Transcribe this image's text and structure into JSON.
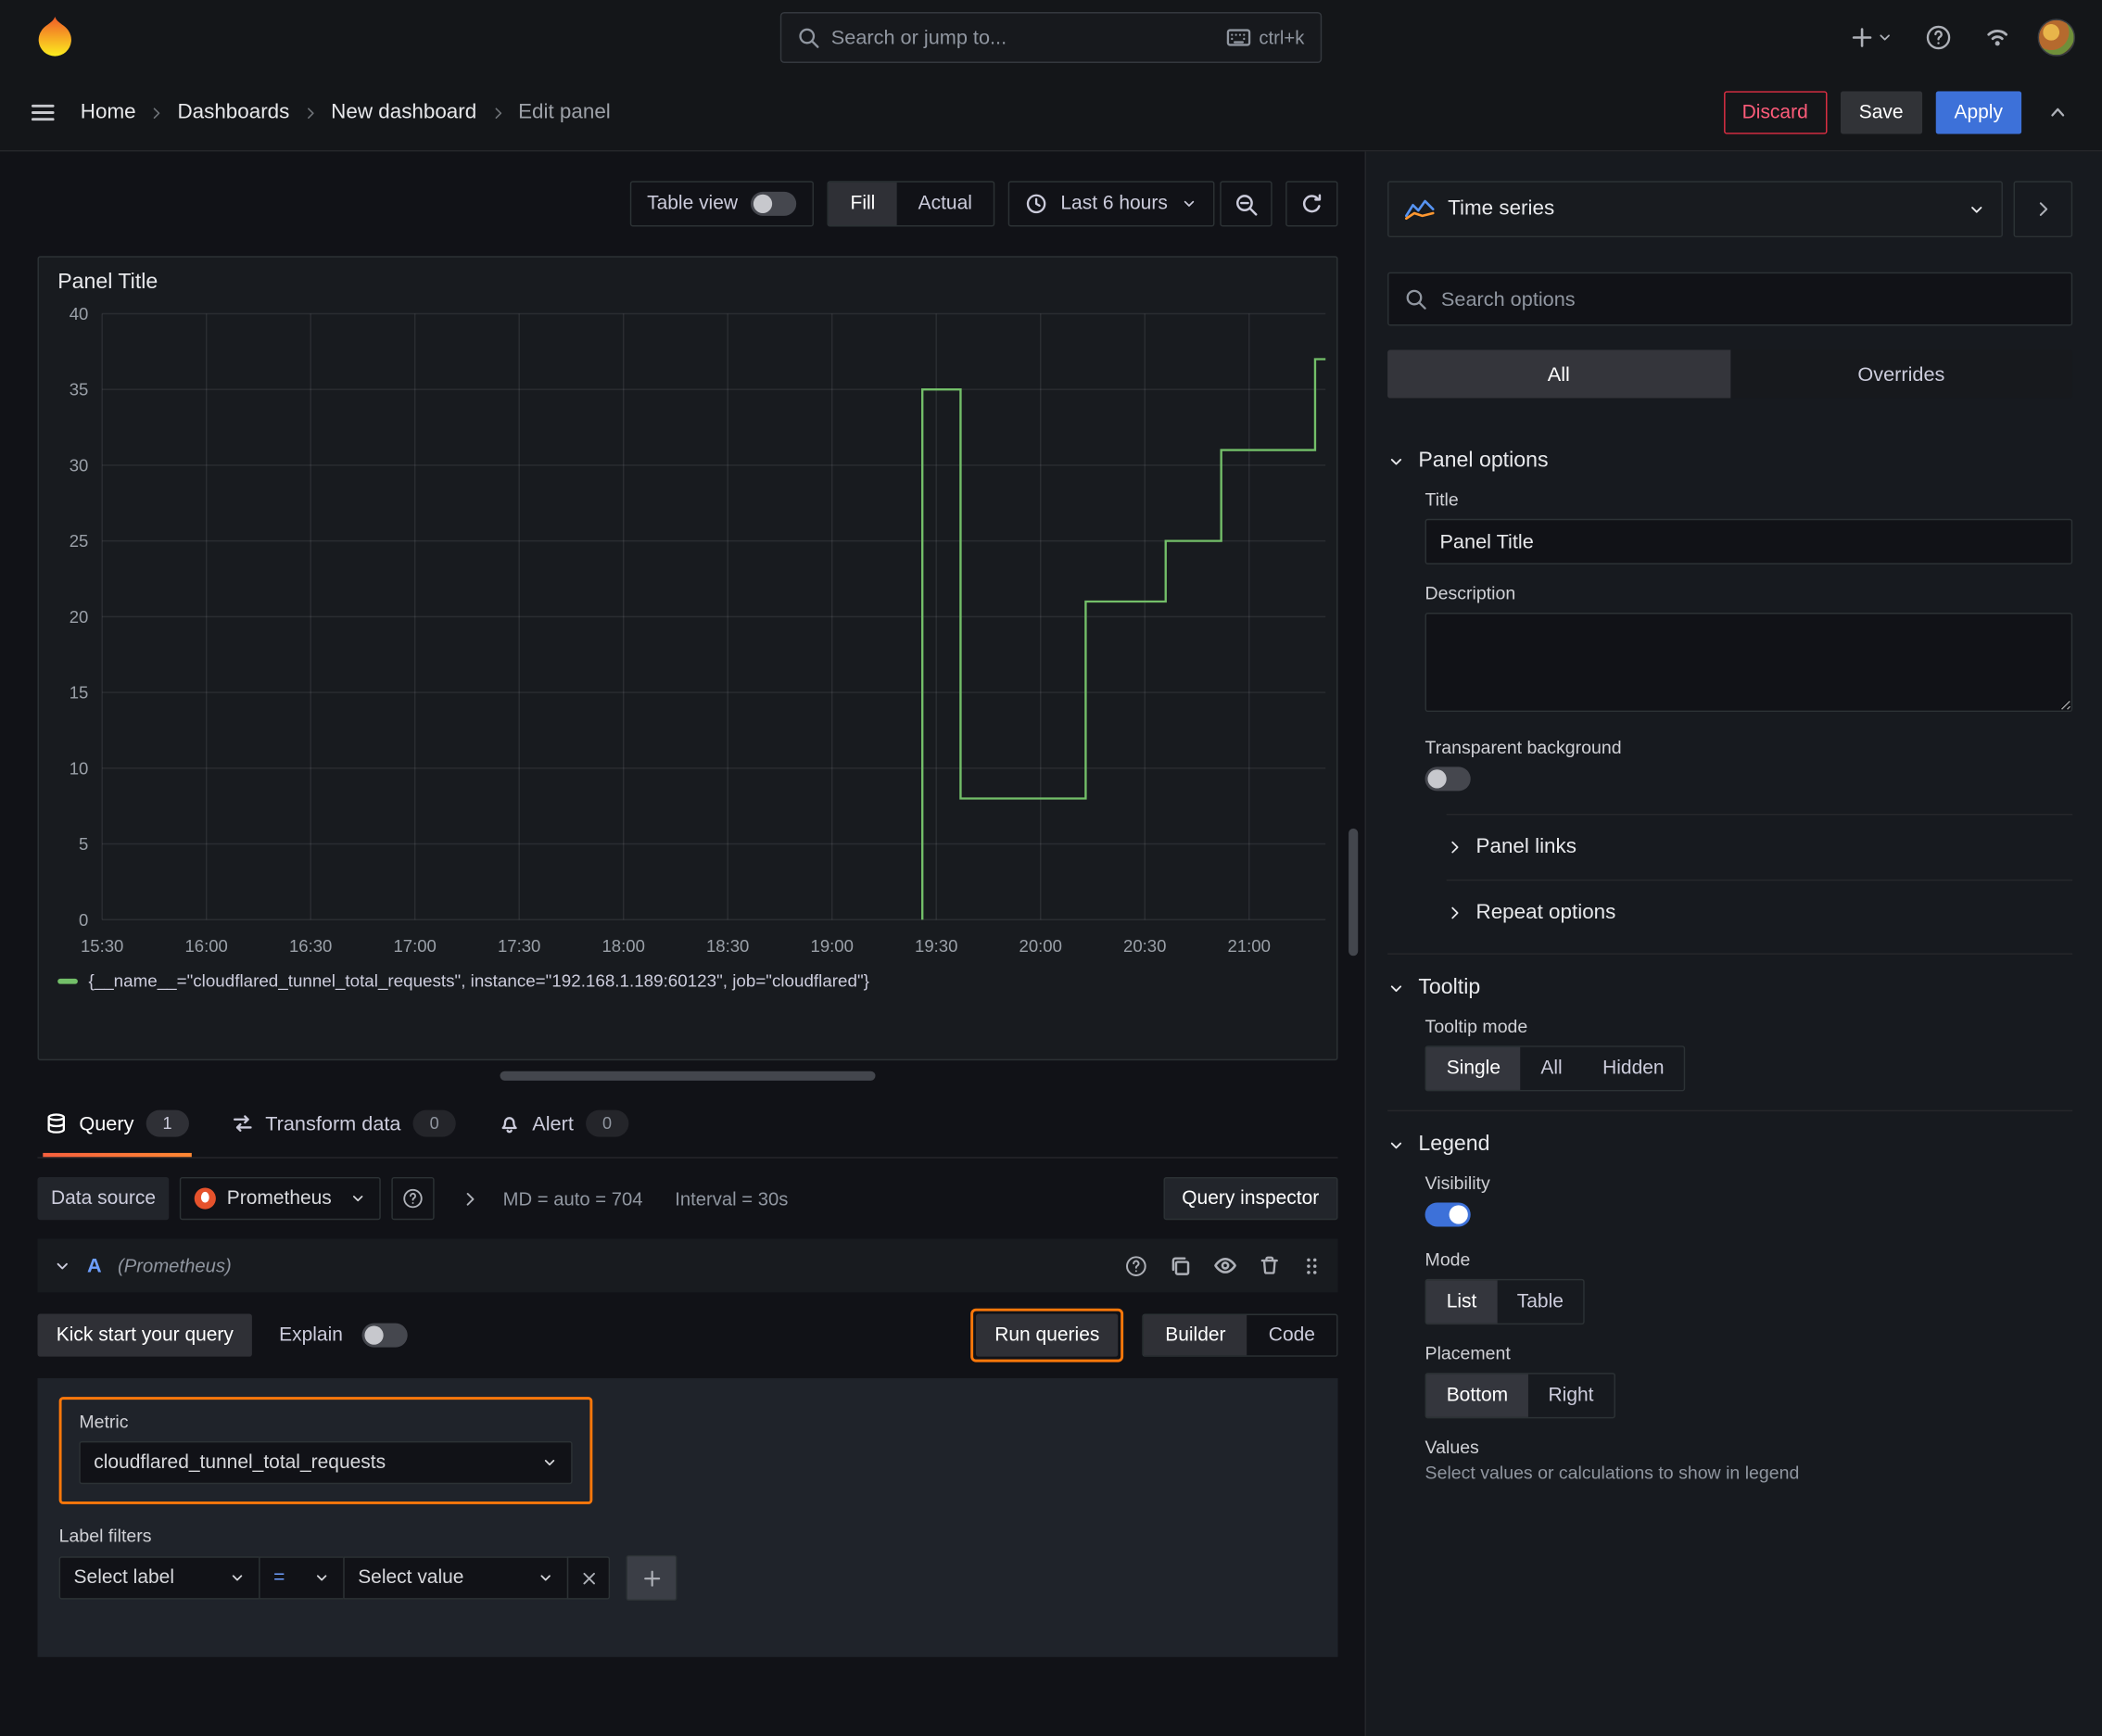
{
  "topnav": {
    "search_placeholder": "Search or jump to...",
    "shortcut": "ctrl+k"
  },
  "nav": {
    "breadcrumbs": [
      "Home",
      "Dashboards",
      "New dashboard",
      "Edit panel"
    ],
    "discard": "Discard",
    "save": "Save",
    "apply": "Apply"
  },
  "toolbar": {
    "table_view": "Table view",
    "fill": "Fill",
    "actual": "Actual",
    "time_range": "Last 6 hours"
  },
  "panel": {
    "title": "Panel Title"
  },
  "chart_data": {
    "type": "line",
    "step": true,
    "title": "Panel Title",
    "grid": true,
    "legend_position": "bottom",
    "ylim": [
      0,
      40
    ],
    "y_ticks": [
      0,
      5,
      10,
      15,
      20,
      25,
      30,
      35,
      40
    ],
    "x_ticks": [
      "15:30",
      "16:00",
      "16:30",
      "17:00",
      "17:30",
      "18:00",
      "18:30",
      "19:00",
      "19:30",
      "20:00",
      "20:30",
      "21:00"
    ],
    "x_tick_minutes": [
      0,
      30,
      60,
      90,
      120,
      150,
      180,
      210,
      240,
      270,
      300,
      330
    ],
    "x_range_minutes": [
      0,
      352
    ],
    "series": [
      {
        "name": "{__name__=\"cloudflared_tunnel_total_requests\", instance=\"192.168.1.189:60123\", job=\"cloudflared\"}",
        "color": "#73bf69",
        "points": [
          [
            236,
            0
          ],
          [
            236,
            35
          ],
          [
            247,
            35
          ],
          [
            247,
            8
          ],
          [
            283,
            8
          ],
          [
            283,
            21
          ],
          [
            306,
            21
          ],
          [
            306,
            25
          ],
          [
            322,
            25
          ],
          [
            322,
            31
          ],
          [
            349,
            31
          ],
          [
            349,
            37
          ],
          [
            352,
            37
          ]
        ]
      }
    ]
  },
  "tabs": {
    "query": "Query",
    "query_count": "1",
    "transform": "Transform data",
    "transform_count": "0",
    "alert": "Alert",
    "alert_count": "0"
  },
  "query": {
    "data_source_label": "Data source",
    "data_source": "Prometheus",
    "md_stat": "MD = auto = 704",
    "interval_stat": "Interval = 30s",
    "query_inspector": "Query inspector",
    "ref_id": "A",
    "ref_ds": "(Prometheus)",
    "kick_start": "Kick start your query",
    "explain": "Explain",
    "run_queries": "Run queries",
    "builder": "Builder",
    "code": "Code",
    "metric_label": "Metric",
    "metric_value": "cloudflared_tunnel_total_requests",
    "label_filters_label": "Label filters",
    "select_label": "Select label",
    "operator": "=",
    "select_value": "Select value"
  },
  "sidebar": {
    "viz_type": "Time series",
    "search_placeholder": "Search options",
    "tabs": {
      "all": "All",
      "overrides": "Overrides"
    },
    "panel_options": {
      "heading": "Panel options",
      "title_label": "Title",
      "title_value": "Panel Title",
      "description_label": "Description",
      "transparent_label": "Transparent background",
      "panel_links": "Panel links",
      "repeat_options": "Repeat options"
    },
    "tooltip": {
      "heading": "Tooltip",
      "mode_label": "Tooltip mode",
      "options": [
        "Single",
        "All",
        "Hidden"
      ],
      "selected": "Single"
    },
    "legend": {
      "heading": "Legend",
      "visibility_label": "Visibility",
      "mode_label": "Mode",
      "mode_options": [
        "List",
        "Table"
      ],
      "placement_label": "Placement",
      "placement_options": [
        "Bottom",
        "Right"
      ],
      "values_label": "Values",
      "values_help": "Select values or calculations to show in legend"
    }
  }
}
